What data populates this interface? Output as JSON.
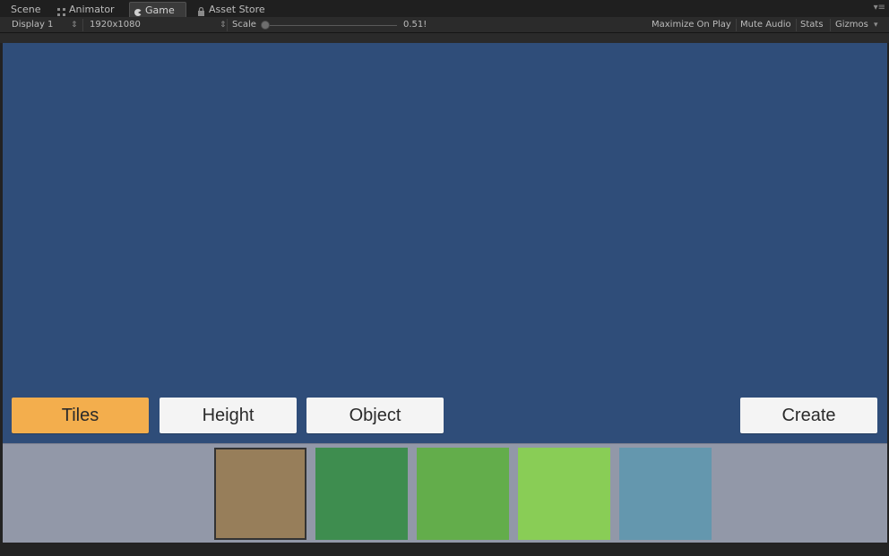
{
  "tabs": [
    {
      "label": "Scene",
      "icon": "scene-icon"
    },
    {
      "label": "Animator",
      "icon": "animator-icon"
    },
    {
      "label": "Game",
      "icon": "game-icon",
      "active": true
    },
    {
      "label": "Asset Store",
      "icon": "lock-icon"
    }
  ],
  "toolbar": {
    "display": "Display 1",
    "resolution": "1920x1080",
    "scale_label": "Scale",
    "scale_value": "0.51!",
    "maximize": "Maximize On Play",
    "mute": "Mute Audio",
    "stats": "Stats",
    "gizmos": "Gizmos"
  },
  "game": {
    "background": "#2f4d79",
    "buttons": {
      "tiles": "Tiles",
      "height": "Height",
      "object": "Object",
      "create": "Create"
    },
    "selected_button": "tiles",
    "accent": "#f3ae4d"
  },
  "palette": {
    "background": "#9298a8",
    "swatches": [
      {
        "name": "dirt",
        "color": "#977e5a",
        "selected": true
      },
      {
        "name": "dark-green",
        "color": "#3e8d4f",
        "selected": false
      },
      {
        "name": "green",
        "color": "#63ad4b",
        "selected": false
      },
      {
        "name": "light-green",
        "color": "#89cd56",
        "selected": false
      },
      {
        "name": "water-blue",
        "color": "#6497ae",
        "selected": false
      }
    ]
  }
}
